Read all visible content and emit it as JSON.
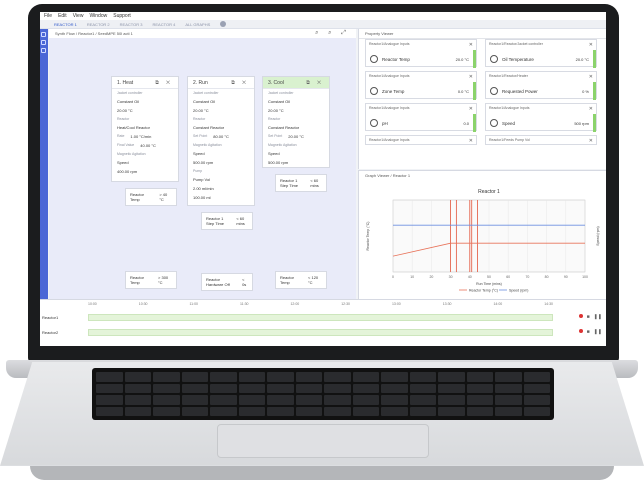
{
  "menu": [
    "File",
    "Edit",
    "View",
    "Window",
    "Support"
  ],
  "tabs": [
    "REACTOR 1",
    "REACTOR 2",
    "REACTOR 3",
    "REACTOR 4",
    "ALL GRAPHS"
  ],
  "schedule": {
    "title": "Synth Flow / Reactor1 / SeedMPE 50l acti 1",
    "steps": [
      {
        "title": "1. Heat",
        "sub1": "Jacket controller",
        "v1": "Constant Oil",
        "setpoint": "20.00 °C",
        "mode_lbl": "Reactor",
        "mode": "Heat/Cool Reactor",
        "rate_lbl": "Rate",
        "rate": "1.00 °C/min",
        "final_lbl": "Final Value",
        "final": "40.00 °C",
        "agit_lbl": "Magnetic Agitation",
        "agit": "Speed",
        "agit_sp": "400.00 rpm"
      },
      {
        "title": "2. Run",
        "sub1": "Jacket controller",
        "v1": "Constant Oil",
        "setpoint": "20.00 °C",
        "mode_lbl": "Reactor",
        "mode": "Constant Reactor",
        "rate_lbl": "Set Point",
        "rate": "80.00 °C",
        "agit_lbl": "Magnetic Agitation",
        "agit": "Speed",
        "agit_sp": "500.00 rpm",
        "pump_lbl": "Pump",
        "pump": "Pump Vol",
        "pump_rate": "2.00 ml/min",
        "pump_total": "100.00 ml"
      },
      {
        "title": "3. Cool",
        "sub1": "Jacket controller",
        "v1": "Constant Oil",
        "setpoint": "20.00 °C",
        "mode_lbl": "Reactor",
        "mode": "Constant Reactor",
        "rate_lbl": "Set Point",
        "rate": "20.00 °C",
        "agit_lbl": "Magnetic Agitation",
        "agit": "Speed",
        "agit_sp": "500.00 rpm"
      }
    ],
    "conditions": [
      {
        "label": "Reactor Temp",
        "value": "> 40 °C"
      },
      {
        "label": "Reactor 1 Step Time",
        "value": "< 60 mins"
      },
      {
        "label": "Reactor 1 Step Time",
        "value": "< 60 mins"
      }
    ],
    "bottom_conditions": [
      {
        "label": "Reactor Temp",
        "value": "> 300 °C"
      },
      {
        "label": "Reactor Hardware Off",
        "value": "< 0s"
      },
      {
        "label": "Reactor Temp",
        "value": "< 120 °C"
      }
    ]
  },
  "property_viewer": {
    "title": "Property Viewer",
    "cards": [
      {
        "hdr": "Reactor1/Analogue Inputs",
        "name": "Reactor Temp",
        "val": "20.0",
        "unit": "°C"
      },
      {
        "hdr": "Reactor1/Reactor/Jacket controller",
        "name": "Oil Temperature",
        "val": "20.0",
        "unit": "°C"
      },
      {
        "hdr": "Reactor1/Analogue Inputs",
        "name": "Zone Temp",
        "val": "0.0",
        "unit": "°C"
      },
      {
        "hdr": "Reactor1/Reactor/Heater",
        "name": "Requested Power",
        "val": "0",
        "unit": "%"
      },
      {
        "hdr": "Reactor1/Analogue Inputs",
        "name": "pH",
        "val": "0.0",
        "unit": ""
      },
      {
        "hdr": "Reactor1/Analogue Inputs",
        "name": "Speed",
        "val": "500",
        "unit": "rpm"
      },
      {
        "hdr": "Reactor1/Analogue Inputs",
        "name": "",
        "val": "",
        "unit": ""
      },
      {
        "hdr": "Reactor1/Feeds Pump Vol",
        "name": "",
        "val": "",
        "unit": ""
      }
    ]
  },
  "chart": {
    "panel_title": "Graph Viewer / Reactor 1",
    "chart_data": {
      "type": "line",
      "title": "Reactor 1",
      "xlabel": "Run Time (mins)",
      "ylabel": "Reactor Temp (°C)",
      "y2label": "Speed (rpm)",
      "xlim": [
        0,
        100
      ],
      "ylim": [
        0,
        100
      ],
      "x_ticks": [
        "0",
        "10",
        "20",
        "30",
        "40",
        "50",
        "60",
        "70",
        "80",
        "90",
        "100"
      ],
      "series": [
        {
          "name": "Reactor Temp (°C)",
          "color": "#e8735a",
          "x": [
            0,
            30,
            35,
            100
          ],
          "y": [
            22,
            40,
            40,
            40
          ]
        },
        {
          "name": "Speed (rpm)",
          "color": "#6d8fe0",
          "x": [
            0,
            100
          ],
          "y": [
            65,
            65
          ]
        }
      ],
      "markers": [
        30,
        33,
        40,
        41,
        44
      ]
    }
  },
  "timeline": {
    "scale": [
      "10:00",
      "10:30",
      "11:00",
      "11:30",
      "12:00",
      "12:30",
      "13:00",
      "13:30",
      "14:00",
      "14:30"
    ],
    "rows": [
      "Reactor1",
      "Reactor2"
    ]
  }
}
